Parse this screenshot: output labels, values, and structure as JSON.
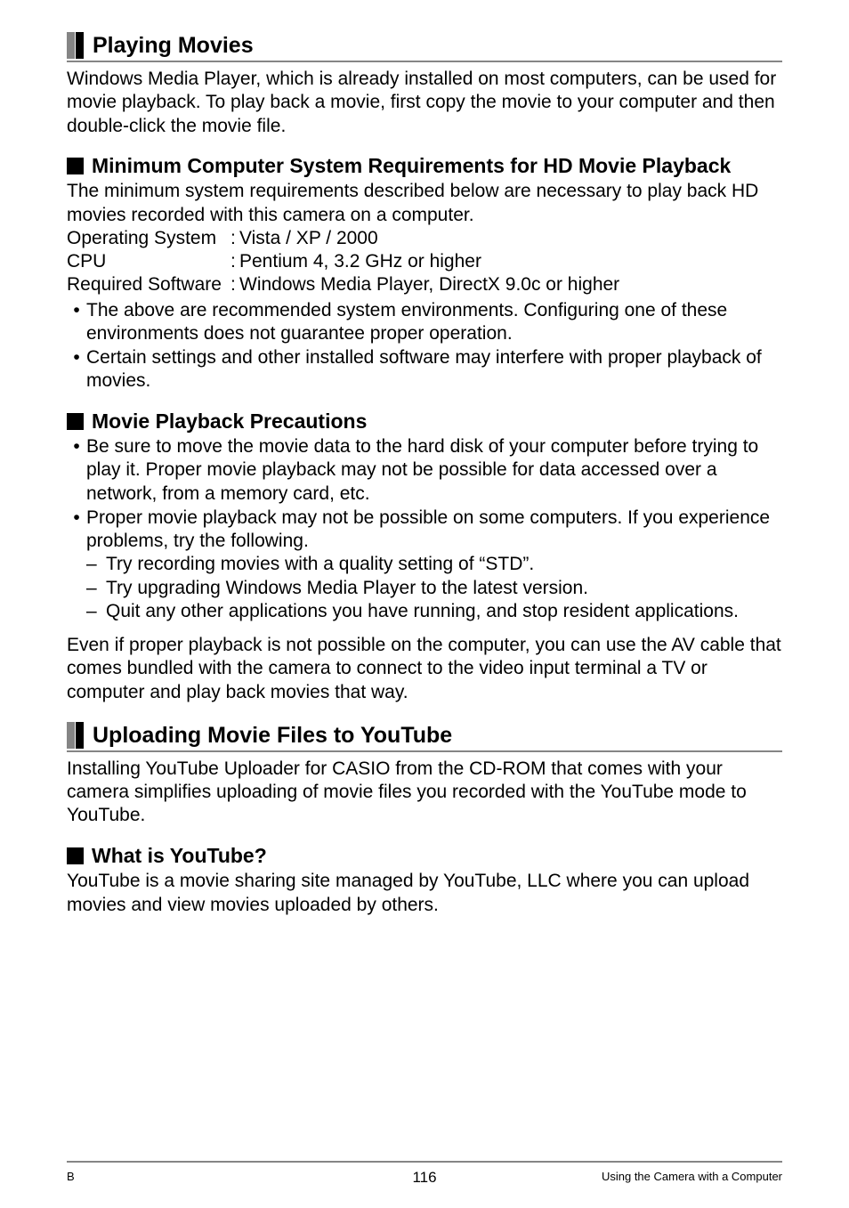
{
  "section1": {
    "title": "Playing Movies",
    "intro": "Windows Media Player, which is already installed on most computers, can be used for movie playback. To play back a movie, first copy the movie to your computer and then double-click the movie file.",
    "sub1": {
      "title": "Minimum Computer System Requirements for HD Movie Playback",
      "lead": "The minimum system requirements described below are necessary to play back HD movies recorded with this camera on a computer.",
      "specs": [
        {
          "label": "Operating System",
          "value": "Vista / XP / 2000"
        },
        {
          "label": "CPU",
          "value": "Pentium 4, 3.2 GHz or higher"
        },
        {
          "label": "Required Software",
          "value": "Windows Media Player, DirectX 9.0c or higher"
        }
      ],
      "bullets": [
        "The above are recommended system environments. Configuring one of these environments does not guarantee proper operation.",
        "Certain settings and other installed software may interfere with proper playback of movies."
      ]
    },
    "sub2": {
      "title": "Movie Playback Precautions",
      "bullets": [
        {
          "text": "Be sure to move the movie data to the hard disk of your computer before trying to play it. Proper movie playback may not be possible for data accessed over a network, from a memory card, etc."
        },
        {
          "text": "Proper movie playback may not be possible on some computers. If you experience problems, try the following.",
          "dashes": [
            "Try recording movies with a quality setting of “STD”.",
            "Try upgrading Windows Media Player to the latest version.",
            "Quit any other applications you have running, and stop resident applications."
          ]
        }
      ],
      "closing": "Even if proper playback is not possible on the computer, you can use the AV cable that comes bundled with the camera to connect to the video input terminal a TV or computer and play back movies that way."
    }
  },
  "section2": {
    "title": "Uploading Movie Files to YouTube",
    "intro": "Installing YouTube Uploader for CASIO from the CD-ROM that comes with your camera simplifies uploading of movie files you recorded with the YouTube mode to YouTube.",
    "sub1": {
      "title": "What is YouTube?",
      "text": "YouTube is a movie sharing site managed by YouTube, LLC where you can upload movies and view movies uploaded by others."
    }
  },
  "footer": {
    "left": "B",
    "center": "116",
    "right": "Using the Camera with a Computer"
  }
}
